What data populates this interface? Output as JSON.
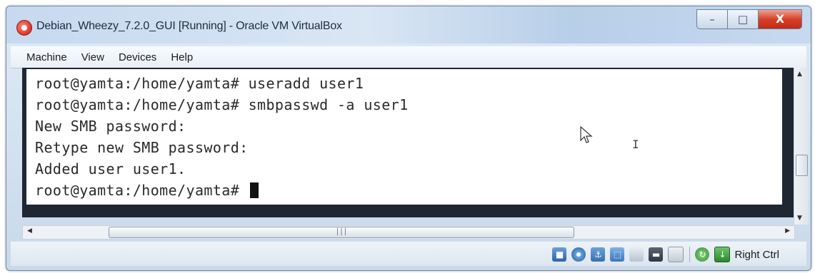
{
  "window": {
    "title": "Debian_Wheezy_7.2.0_GUI [Running] - Oracle VM VirtualBox",
    "controls": {
      "minimize_icon": "minimize-icon",
      "maximize_icon": "maximize-icon",
      "close_icon": "close-icon"
    }
  },
  "menu": [
    "Machine",
    "View",
    "Devices",
    "Help"
  ],
  "terminal": {
    "lines": [
      "root@yamta:/home/yamta# useradd user1",
      "root@yamta:/home/yamta# smbpasswd -a user1",
      "New SMB password:",
      "Retype new SMB password:",
      "Added user user1.",
      "root@yamta:/home/yamta# "
    ]
  },
  "status": {
    "icons": [
      "hard-disk-icon",
      "optical-drive-icon",
      "usb-icon",
      "network-icon",
      "shared-folders-icon",
      "display-icon",
      "recording-icon",
      "mouse-integration-icon",
      "host-key-icon"
    ],
    "host_key_label": "Right Ctrl"
  },
  "colors": {
    "accent_close": "#d5412b",
    "screen_bg": "#1f2733",
    "console_bg": "#ffffff"
  }
}
